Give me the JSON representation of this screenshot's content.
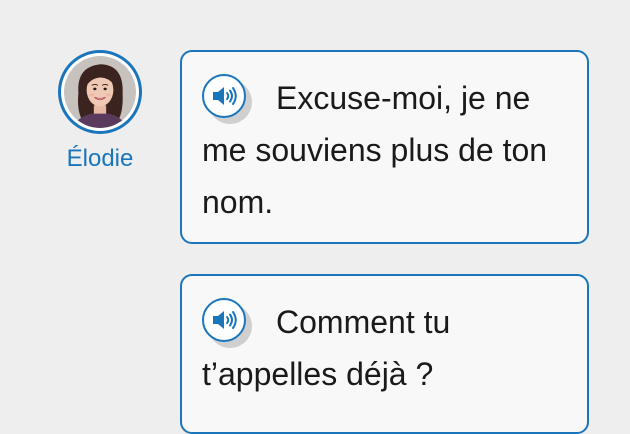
{
  "speaker": {
    "name": "Élodie"
  },
  "messages": [
    {
      "text": "Excuse-moi, je ne me souviens plus de ton nom."
    },
    {
      "text": "Comment tu t’appelles déjà ?"
    }
  ],
  "icons": {
    "audio": "speaker-volume-icon",
    "avatar": "woman-portrait"
  },
  "colors": {
    "accent": "#1a75bb",
    "bubble_bg": "#f8f8f8",
    "page_bg": "#eeeeee",
    "text": "#1a1a1a"
  }
}
